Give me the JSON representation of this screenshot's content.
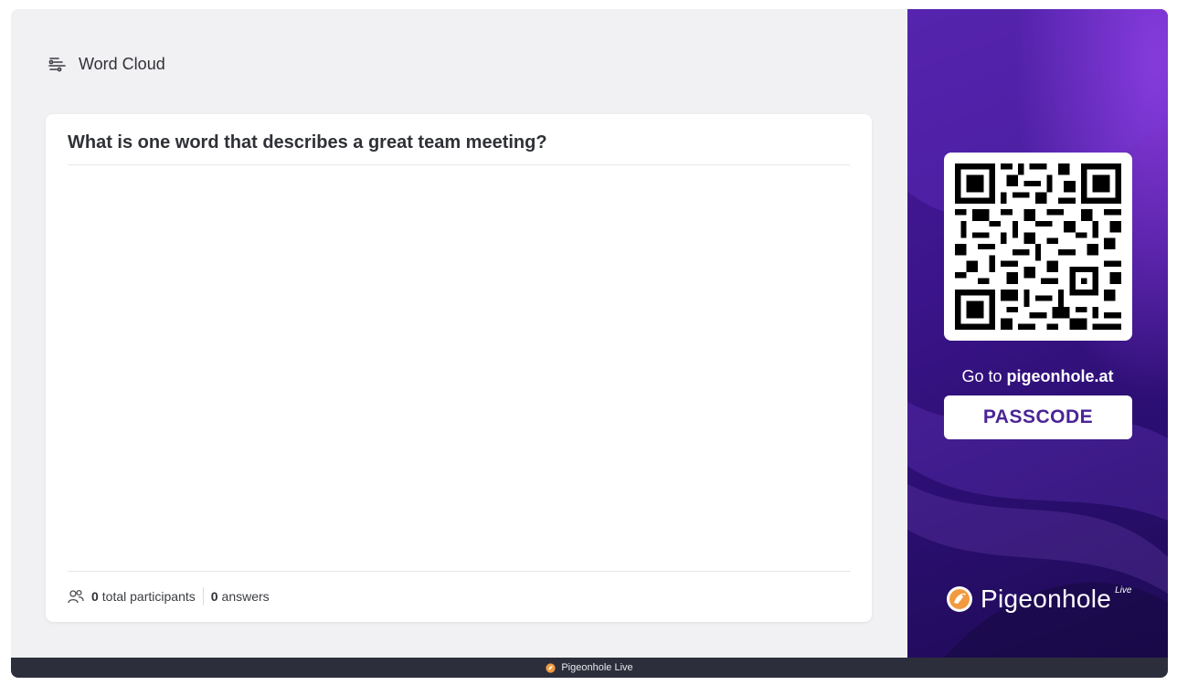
{
  "header": {
    "title": "Word Cloud",
    "icon": "word-cloud-icon"
  },
  "card": {
    "question": "What is one word that describes a great team meeting?",
    "stats": {
      "participants_count": "0",
      "participants_label": "total participants",
      "answers_count": "0",
      "answers_label": "answers"
    }
  },
  "sidebar": {
    "goto_prefix": "Go to",
    "goto_url": "pigeonhole.at",
    "passcode": "PASSCODE",
    "brand": "Pigeonhole",
    "brand_suffix": "Live"
  },
  "footer": {
    "label": "Pigeonhole Live"
  },
  "colors": {
    "accent": "#4a2496",
    "sidebar_bg": "#3a1489",
    "footer_bg": "#2c2f3b",
    "brand_orange": "#f29a3f"
  }
}
